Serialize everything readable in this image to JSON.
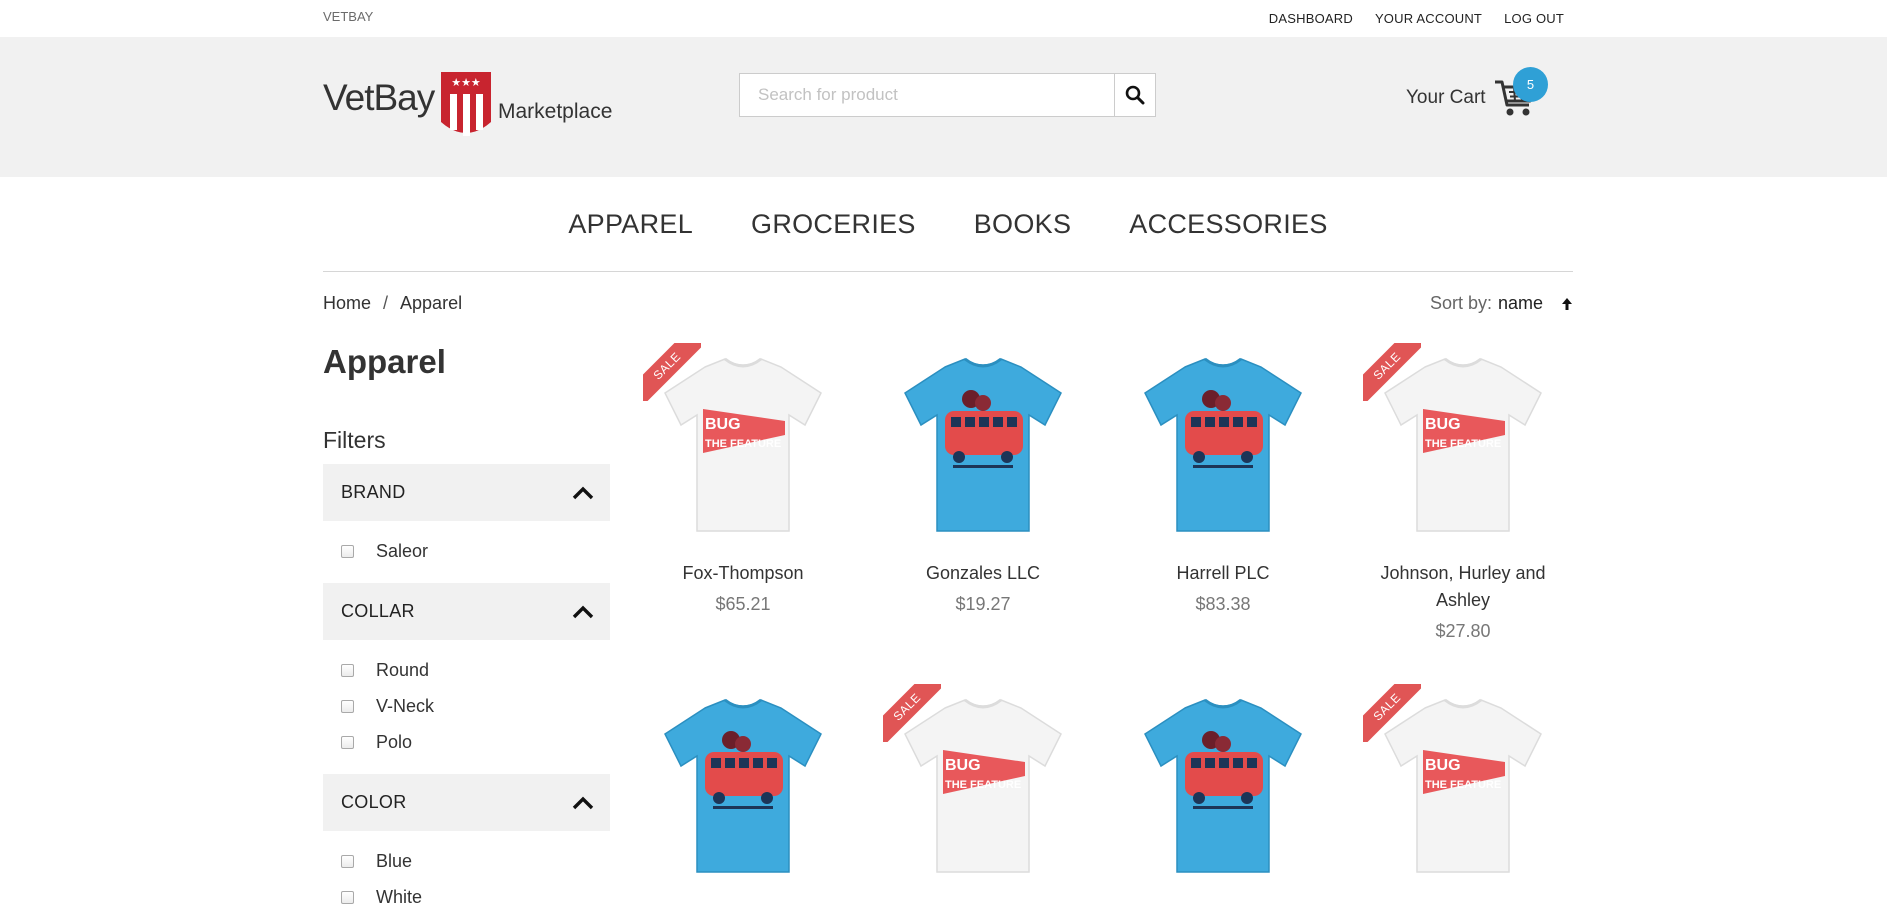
{
  "topbar": {
    "brand": "VETBAY",
    "links": [
      "DASHBOARD",
      "YOUR ACCOUNT",
      "LOG OUT"
    ]
  },
  "header": {
    "logo": {
      "word": "VetBay",
      "sub": "Marketplace"
    },
    "search": {
      "placeholder": "Search for product",
      "value": ""
    },
    "cart": {
      "label": "Your Cart",
      "count": "5"
    }
  },
  "nav": [
    "APPAREL",
    "GROCERIES",
    "BOOKS",
    "ACCESSORIES"
  ],
  "breadcrumb": [
    "Home",
    "/",
    "Apparel"
  ],
  "sort": {
    "key": "Sort by:",
    "value": "name"
  },
  "page_title": "Apparel",
  "filters_title": "Filters",
  "filters": [
    {
      "title": "BRAND",
      "options": [
        "Saleor"
      ]
    },
    {
      "title": "COLLAR",
      "options": [
        "Round",
        "V-Neck",
        "Polo"
      ]
    },
    {
      "title": "COLOR",
      "options": [
        "Blue",
        "White"
      ]
    }
  ],
  "products": [
    {
      "name": "Fox-Thompson",
      "price": "$65.21",
      "sale": true,
      "shirt": "white"
    },
    {
      "name": "Gonzales LLC",
      "price": "$19.27",
      "sale": false,
      "shirt": "blue"
    },
    {
      "name": "Harrell PLC",
      "price": "$83.38",
      "sale": false,
      "shirt": "blue"
    },
    {
      "name": "Johnson, Hurley and Ashley",
      "price": "$27.80",
      "sale": true,
      "shirt": "white"
    },
    {
      "name": "",
      "price": "",
      "sale": false,
      "shirt": "blue"
    },
    {
      "name": "",
      "price": "",
      "sale": true,
      "shirt": "white"
    },
    {
      "name": "",
      "price": "",
      "sale": false,
      "shirt": "blue"
    },
    {
      "name": "",
      "price": "",
      "sale": true,
      "shirt": "white"
    }
  ],
  "sale_label": "SALE",
  "colors": {
    "accent": "#2fa0d6",
    "sale": "#e05555",
    "shirt_blue": "#3eaadd",
    "shirt_white": "#f4f4f4",
    "header_bg": "#f1f1f1"
  }
}
